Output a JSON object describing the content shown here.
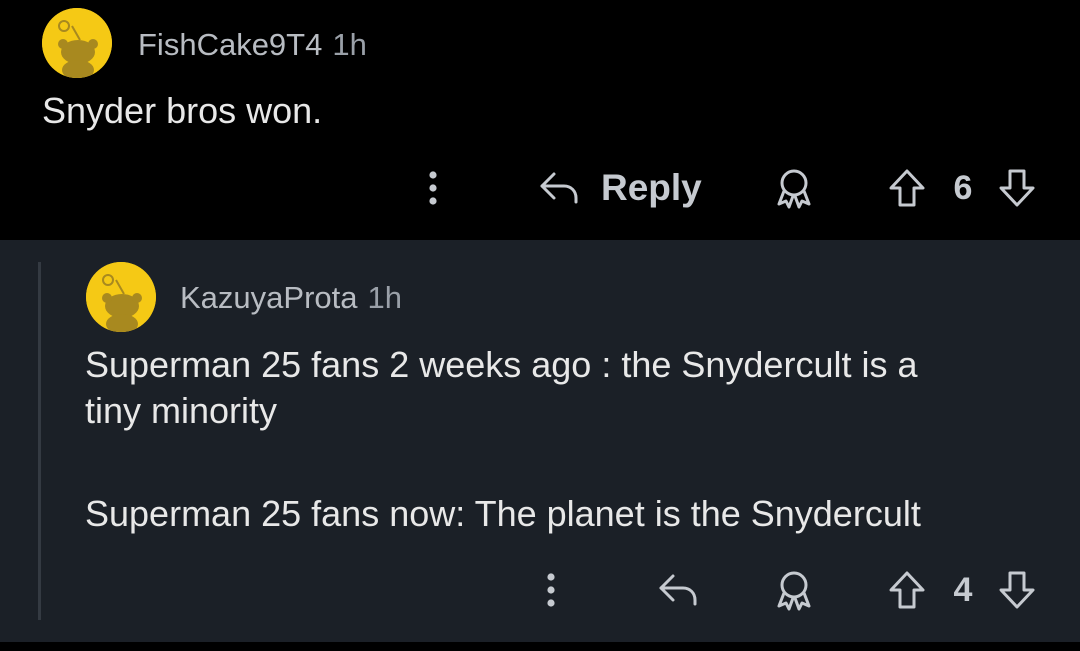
{
  "comments": [
    {
      "username": "FishCake9T4",
      "time": "1h",
      "lines": [
        "Snyder bros won."
      ],
      "actions": {
        "more_icon": "more-vertical-icon",
        "reply_icon": "reply-arrow-icon",
        "reply_label": "Reply",
        "award_icon": "award-icon",
        "upvote_icon": "upvote-arrow-icon",
        "score": "6",
        "downvote_icon": "downvote-arrow-icon"
      }
    },
    {
      "username": "KazuyaProta",
      "time": "1h",
      "lines": [
        "Superman 25 fans 2 weeks ago : the Snydercult is a",
        "tiny minority",
        "Superman 25 fans now: The planet is the Snydercult"
      ],
      "actions": {
        "more_icon": "more-vertical-icon",
        "reply_icon": "reply-arrow-icon",
        "award_icon": "award-icon",
        "upvote_icon": "upvote-arrow-icon",
        "score": "4",
        "downvote_icon": "downvote-arrow-icon"
      }
    }
  ],
  "colors": {
    "top_background": "#000000",
    "reply_background": "#1b2027",
    "avatar": "#f5c915",
    "text": "#e8e8e8",
    "meta_text": "#b8bcc2"
  }
}
